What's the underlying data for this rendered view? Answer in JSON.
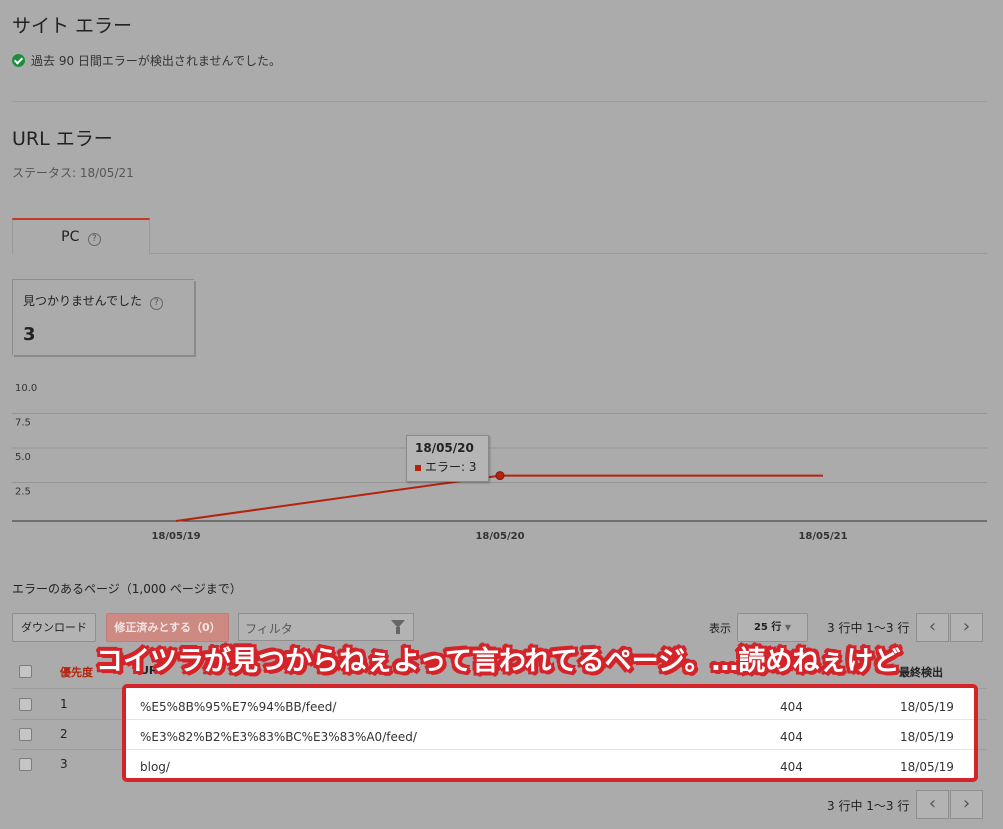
{
  "site_errors": {
    "title": "サイト エラー",
    "status_text": "過去 90 日間エラーが検出されませんでした。"
  },
  "url_errors": {
    "title": "URL エラー",
    "status_label": "ステータス: 18/05/21"
  },
  "tabs": [
    {
      "label": "PC",
      "help": "?"
    }
  ],
  "summary_card": {
    "label": "見つかりませんでした",
    "help": "?",
    "value": "3"
  },
  "chart_data": {
    "type": "line",
    "x": [
      "18/05/19",
      "18/05/20",
      "18/05/21"
    ],
    "series": [
      {
        "name": "エラー",
        "values": [
          0,
          3,
          3
        ]
      }
    ],
    "y_ticks": [
      "10.0",
      "7.5",
      "5.0",
      "2.5"
    ],
    "ylim": [
      0,
      10
    ],
    "grid": true,
    "tooltip": {
      "date": "18/05/20",
      "label": "エラー: 3"
    },
    "color": "#b4230e"
  },
  "table_section": {
    "title": "エラーのあるページ（1,000 ページまで）",
    "download_label": "ダウンロード",
    "mark_fixed_label": "修正済みとする（0）",
    "filter_placeholder": "フィルタ",
    "show_label": "表示",
    "rows_select": "25 行",
    "pagination_text": "3 行中 1〜3 行",
    "prev": "‹",
    "next": "›",
    "headers": {
      "priority": "優先度",
      "url": "URL",
      "last_detected": "最終検出"
    }
  },
  "rows": [
    {
      "priority": "1",
      "url": "%E5%8B%95%E7%94%BB/feed/",
      "code": "404",
      "date": "18/05/19"
    },
    {
      "priority": "2",
      "url": "%E3%82%B2%E3%83%BC%E3%83%A0/feed/",
      "code": "404",
      "date": "18/05/19"
    },
    {
      "priority": "3",
      "url": "blog/",
      "code": "404",
      "date": "18/05/19"
    }
  ],
  "annotation_text": "コイツラが見つからねぇよって言われてるページ。…読めねぇけど",
  "colors": {
    "accent": "#c23b22",
    "annotation": "#d4242a",
    "status_ok": "#1e8e3e"
  }
}
